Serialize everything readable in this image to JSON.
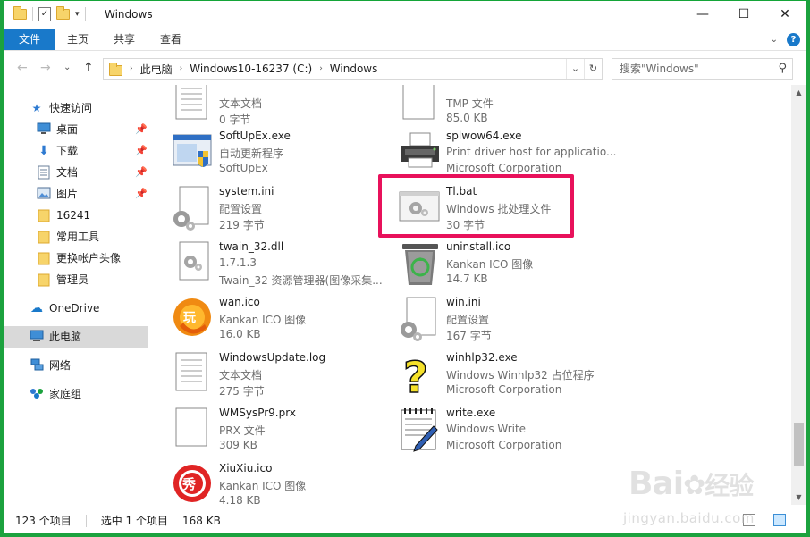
{
  "titlebar": {
    "title": "Windows",
    "minimize_glyph": "—",
    "maximize_glyph": "☐",
    "close_glyph": "✕",
    "qa_check_glyph": "✓",
    "qa_drop_glyph": "▾"
  },
  "ribbon": {
    "tabs": [
      "文件",
      "主页",
      "共享",
      "查看"
    ],
    "expand_glyph": "⌄",
    "help_glyph": "?"
  },
  "navigation": {
    "back_glyph": "←",
    "forward_glyph": "→",
    "recent_glyph": "⌄",
    "up_glyph": "↑",
    "breadcrumb": [
      "此电脑",
      "Windows10-16237 (C:)",
      "Windows"
    ],
    "breadcrumb_sep": "›",
    "refresh_glyph": "↻",
    "dropdown_glyph": "⌄",
    "search_placeholder": "搜索\"Windows\"",
    "search_glyph": "⚲"
  },
  "nav_pane": {
    "quick_access": "快速访问",
    "quick_items": [
      "桌面",
      "下载",
      "文档",
      "图片",
      "16241",
      "常用工具",
      "更换帐户头像",
      "管理员"
    ],
    "pin_glyph": "📌",
    "onedrive": "OneDrive",
    "this_pc": "此电脑",
    "network": "网络",
    "homegroup": "家庭组"
  },
  "files": [
    {
      "name": "",
      "type": "文本文档",
      "detail": "0 字节",
      "icon": "text-document-icon"
    },
    {
      "name": "",
      "type": "TMP 文件",
      "detail": "85.0 KB",
      "icon": "blank-file-icon"
    },
    {
      "name": "SoftUpEx.exe",
      "type": "自动更新程序",
      "detail": "SoftUpEx",
      "icon": "application-shield-icon"
    },
    {
      "name": "splwow64.exe",
      "type": "Print driver host for applicatio...",
      "detail": "Microsoft Corporation",
      "icon": "printer-icon"
    },
    {
      "name": "system.ini",
      "type": "配置设置",
      "detail": "219 字节",
      "icon": "settings-file-icon"
    },
    {
      "name": "Tl.bat",
      "type": "Windows 批处理文件",
      "detail": "30 字节",
      "icon": "batch-file-icon"
    },
    {
      "name": "twain_32.dll",
      "type": "1.7.1.3",
      "detail": "Twain_32 资源管理器(图像采集...",
      "icon": "dll-file-icon"
    },
    {
      "name": "uninstall.ico",
      "type": "Kankan ICO 图像",
      "detail": "14.7 KB",
      "icon": "recycle-bin-icon"
    },
    {
      "name": "wan.ico",
      "type": "Kankan ICO 图像",
      "detail": "16.0 KB",
      "icon": "wan-play-icon"
    },
    {
      "name": "win.ini",
      "type": "配置设置",
      "detail": "167 字节",
      "icon": "settings-file-icon"
    },
    {
      "name": "WindowsUpdate.log",
      "type": "文本文档",
      "detail": "275 字节",
      "icon": "text-document-icon"
    },
    {
      "name": "winhlp32.exe",
      "type": "Windows Winhlp32 占位程序",
      "detail": "Microsoft Corporation",
      "icon": "help-question-icon"
    },
    {
      "name": "WMSysPr9.prx",
      "type": "PRX 文件",
      "detail": "309 KB",
      "icon": "blank-file-icon"
    },
    {
      "name": "write.exe",
      "type": "Windows Write",
      "detail": "Microsoft Corporation",
      "icon": "write-notepad-icon"
    },
    {
      "name": "XiuXiu.ico",
      "type": "Kankan ICO 图像",
      "detail": "4.18 KB",
      "icon": "xiuxiu-icon"
    }
  ],
  "scrollbar": {
    "up_glyph": "▲",
    "down_glyph": "▼",
    "position": 0.93
  },
  "status": {
    "count": "123 个项目",
    "selected": "选中 1 个项目",
    "size": "168 KB"
  },
  "watermark": {
    "brand": "Bai",
    "brand_cn": "经验",
    "url": "jingyan.baidu.com"
  },
  "colors": {
    "accent": "#1979ca",
    "highlight": "#e8115b",
    "frame": "#14a538"
  }
}
